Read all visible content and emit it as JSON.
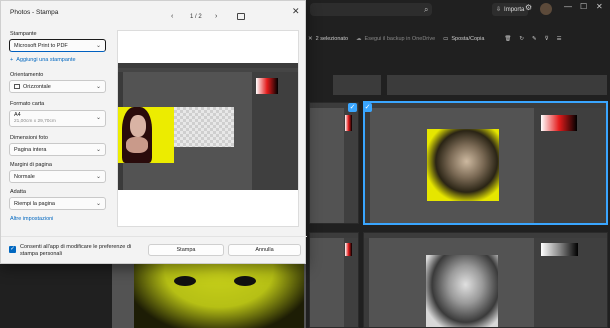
{
  "dialog": {
    "title": "Photos - Stampa",
    "close_glyph": "✕",
    "pager": {
      "prev": "‹",
      "next": "›",
      "label": "1 / 2"
    },
    "printer": {
      "label": "Stampante",
      "value": "Microsoft Print to PDF"
    },
    "add_printer": "Aggiungi una stampante",
    "orientation": {
      "label": "Orientamento",
      "value": "Orizzontale"
    },
    "paper": {
      "label": "Formato carta",
      "value": "A4",
      "sub": "21,00cm x 29,70cm"
    },
    "photo_size": {
      "label": "Dimensioni foto",
      "value": "Pagina intera"
    },
    "margins": {
      "label": "Margini di pagina",
      "value": "Normale"
    },
    "fit": {
      "label": "Adatta",
      "value": "Riempi la pagina"
    },
    "more_settings": "Altre impostazioni",
    "consent": "Consenti all'app di modificare le preferenze di stampa personali",
    "print_button": "Stampa",
    "cancel_button": "Annulla",
    "chevron": "⌄"
  },
  "background": {
    "import_label": "Importa",
    "toolbar": {
      "selected": "2 selezionato",
      "onedrive": "Esegui il backup in OneDrive",
      "move_copy": "Sposta/Copia"
    },
    "window_controls": [
      "—",
      "☐",
      "✕"
    ]
  }
}
